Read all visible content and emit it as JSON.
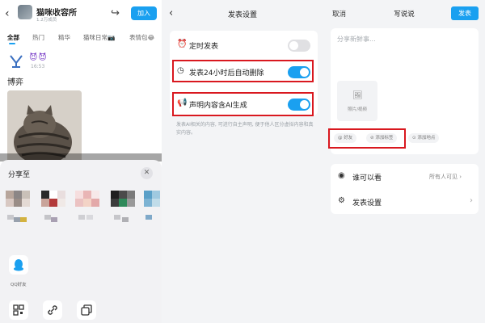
{
  "panel1": {
    "group_name": "猫咪收容所",
    "group_meta": "1.2万成员",
    "join_label": "加入",
    "tabs": [
      "全部",
      "热门",
      "精华",
      "猫咪日常📷",
      "表情包😂"
    ],
    "post": {
      "emojis": "😈😈",
      "time": "16:53",
      "author": "博弈"
    },
    "share": {
      "title": "分享至",
      "close": "✕",
      "qq_label": "QQ好友"
    }
  },
  "panel2": {
    "back": "‹",
    "title": "发表设置",
    "rows": [
      {
        "label": "定时发表",
        "on": false
      },
      {
        "label": "发表24小时后自动删除",
        "on": true
      },
      {
        "label": "声明内容含AI生成",
        "on": true
      }
    ],
    "help": "发表AI相关的内容, 可进行自主声明, 便于他人区分虚拟内容和真实内容。"
  },
  "panel3": {
    "cancel": "取消",
    "title": "写说说",
    "publish": "发表",
    "placeholder": "分享新鲜事...",
    "photo_label": "照片/视频",
    "chips": [
      "@ 好友",
      "⊘ 添加标签",
      "⊙ 添加地点"
    ],
    "options": [
      {
        "label": "谁可以看",
        "value": "所有人可见 ›"
      },
      {
        "label": "发表设置",
        "value": ""
      }
    ]
  },
  "colors": {
    "accent": "#1aa0f0",
    "highlight": "#d9181f"
  }
}
